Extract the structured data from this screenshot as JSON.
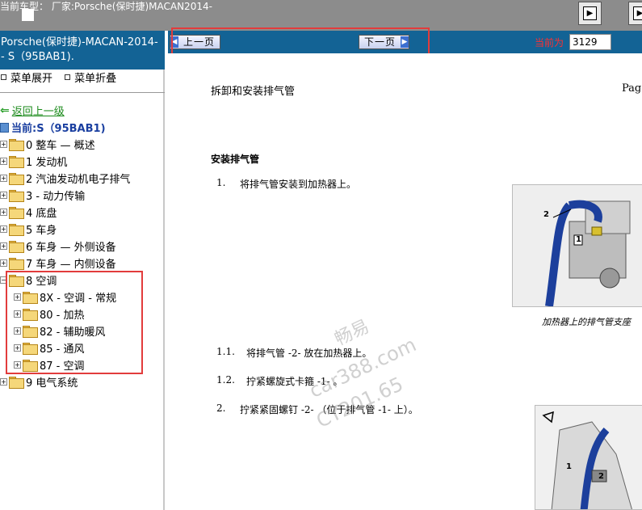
{
  "topbar": {
    "title": "当前车型： 厂家:Porsche(保时捷)MACAN2014-",
    "buttons": [
      "next-icon",
      "next-icon"
    ]
  },
  "sidebar": {
    "header_line1": "Porsche(保时捷)-MACAN-2014-",
    "header_line2": "- S（95BAB1).",
    "expand_label": "菜单展开",
    "collapse_label": "菜单折叠",
    "back_label": "返回上一级",
    "current_label": "当前:S（95BAB1)",
    "items": [
      {
        "label": "0 整车 — 概述"
      },
      {
        "label": "1 发动机"
      },
      {
        "label": "2 汽油发动机电子排气"
      },
      {
        "label": "3 - 动力传输"
      },
      {
        "label": "4 底盘"
      },
      {
        "label": "5 车身"
      },
      {
        "label": "6 车身 — 外侧设备"
      },
      {
        "label": "7 车身 — 内侧设备"
      },
      {
        "label": "8 空调"
      },
      {
        "label": "8X - 空调 - 常规"
      },
      {
        "label": "80 - 加热"
      },
      {
        "label": "82 - 辅助暖风"
      },
      {
        "label": "85 - 通风"
      },
      {
        "label": "87 - 空调"
      },
      {
        "label": "9 电气系统"
      }
    ]
  },
  "nav": {
    "prev_label": "上一页",
    "next_label": "下一页",
    "current_page_label": "当前为",
    "current_page_value": "3129"
  },
  "doc": {
    "title": "拆卸和安装排气管",
    "page_label": "Page",
    "section_title": "安装排气管",
    "steps": [
      {
        "num": "1.",
        "text": "将排气管安装到加热器上。"
      },
      {
        "num": "1.1.",
        "text": "将排气管 -2- 放在加热器上。"
      },
      {
        "num": "1.2.",
        "text": "拧紧螺旋式卡箍 -1- 。"
      },
      {
        "num": "2.",
        "text": "拧紧紧固螺钉 -2- （位于排气管 -1- 上）。"
      }
    ],
    "figure1_caption": "加热器上的排气管支座",
    "figure1_callouts": [
      "2",
      "1"
    ],
    "figure2_callouts": [
      "1",
      "2"
    ]
  },
  "watermark": {
    "line1": "畅易",
    "line2": "car388.com",
    "line3": "CY201.65"
  }
}
